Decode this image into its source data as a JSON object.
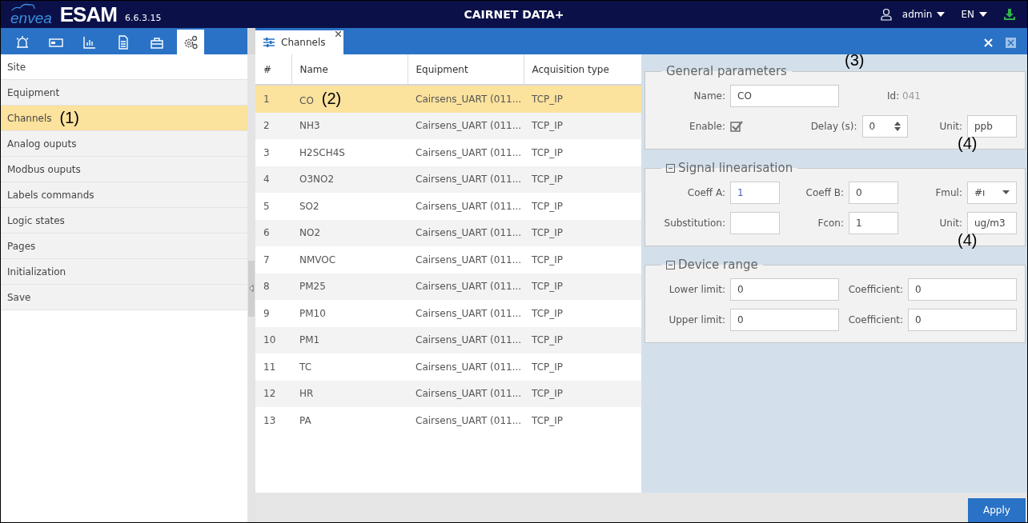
{
  "header": {
    "brand": "envea",
    "product": "ESAM",
    "version": "6.6.3.15",
    "title": "CAIRNET DATA+",
    "user": "admin",
    "language": "EN"
  },
  "toolbar": {
    "tools": [
      {
        "kind": "alarm",
        "selected": false
      },
      {
        "kind": "device",
        "selected": false
      },
      {
        "kind": "chart",
        "selected": false
      },
      {
        "kind": "document",
        "selected": false
      },
      {
        "kind": "toolbox",
        "selected": false
      },
      {
        "kind": "settings",
        "selected": true
      }
    ]
  },
  "sidebar": {
    "items": [
      {
        "label": "Site",
        "selected": false
      },
      {
        "label": "Equipment",
        "selected": false
      },
      {
        "label": "Channels",
        "selected": true,
        "callout": "(1)"
      },
      {
        "label": "Analog ouputs",
        "selected": false
      },
      {
        "label": "Modbus ouputs",
        "selected": false
      },
      {
        "label": "Labels commands",
        "selected": false
      },
      {
        "label": "Logic states",
        "selected": false
      },
      {
        "label": "Pages",
        "selected": false
      },
      {
        "label": "Initialization",
        "selected": false
      },
      {
        "label": "Save",
        "selected": false
      }
    ]
  },
  "tab": {
    "label": "Channels"
  },
  "table": {
    "columns": [
      "#",
      "Name",
      "Equipment",
      "Acquisition type"
    ],
    "rows": [
      {
        "cells": [
          "1",
          "CO",
          "Cairsens_UART (011...",
          "TCP_IP"
        ],
        "selected": true,
        "callout": "(2)"
      },
      {
        "cells": [
          "2",
          "NH3",
          "Cairsens_UART (011...",
          "TCP_IP"
        ],
        "selected": false
      },
      {
        "cells": [
          "3",
          "H2SCH4S",
          "Cairsens_UART (011...",
          "TCP_IP"
        ],
        "selected": false
      },
      {
        "cells": [
          "4",
          "O3NO2",
          "Cairsens_UART (011...",
          "TCP_IP"
        ],
        "selected": false
      },
      {
        "cells": [
          "5",
          "SO2",
          "Cairsens_UART (011...",
          "TCP_IP"
        ],
        "selected": false
      },
      {
        "cells": [
          "6",
          "NO2",
          "Cairsens_UART (011...",
          "TCP_IP"
        ],
        "selected": false
      },
      {
        "cells": [
          "7",
          "NMVOC",
          "Cairsens_UART (011...",
          "TCP_IP"
        ],
        "selected": false
      },
      {
        "cells": [
          "8",
          "PM25",
          "Cairsens_UART (011...",
          "TCP_IP"
        ],
        "selected": false
      },
      {
        "cells": [
          "9",
          "PM10",
          "Cairsens_UART (011...",
          "TCP_IP"
        ],
        "selected": false
      },
      {
        "cells": [
          "10",
          "PM1",
          "Cairsens_UART (011...",
          "TCP_IP"
        ],
        "selected": false
      },
      {
        "cells": [
          "11",
          "TC",
          "Cairsens_UART (011...",
          "TCP_IP"
        ],
        "selected": false
      },
      {
        "cells": [
          "12",
          "HR",
          "Cairsens_UART (011...",
          "TCP_IP"
        ],
        "selected": false
      },
      {
        "cells": [
          "13",
          "PA",
          "Cairsens_UART (011...",
          "TCP_IP"
        ],
        "selected": false
      }
    ]
  },
  "general_parameters": {
    "title": "General parameters",
    "callout": "(3)",
    "name_label": "Name:",
    "name": "CO",
    "id_label": "Id:",
    "id": "041",
    "enable_label": "Enable:",
    "enabled": true,
    "delay_label": "Delay (s):",
    "delay": "0",
    "unit_label": "Unit:",
    "unit": "ppb",
    "unit_callout": "(4)"
  },
  "signal_linearisation": {
    "title": "Signal linearisation",
    "coeff_a_label": "Coeff A:",
    "coeff_a": "1",
    "coeff_b_label": "Coeff B:",
    "coeff_b": "0",
    "fmul_label": "Fmul:",
    "fmul": "#ı",
    "substitution_label": "Substitution:",
    "fcon_label": "Fcon:",
    "fcon": "1",
    "unit_label": "Unit:",
    "unit": "ug/m3",
    "unit_callout": "(4)"
  },
  "device_range": {
    "title": "Device range",
    "rows": [
      {
        "limit_label": "Lower limit:",
        "limit": "0",
        "coefficient_label": "Coefficient:",
        "coefficient": "0"
      },
      {
        "limit_label": "Upper limit:",
        "limit": "0",
        "coefficient_label": "Coefficient:",
        "coefficient": "0"
      }
    ]
  },
  "apply_button": "Apply"
}
